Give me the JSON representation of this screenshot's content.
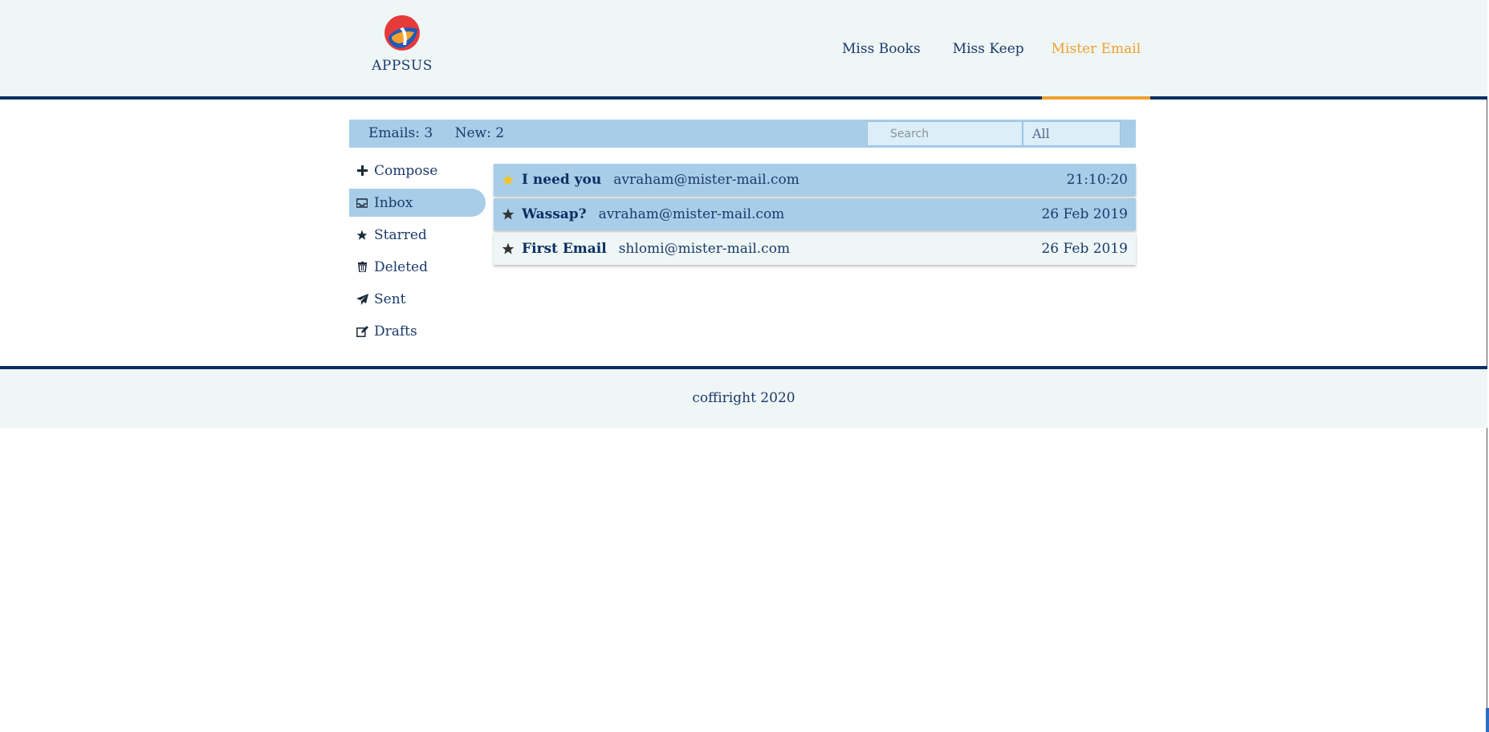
{
  "app": {
    "logo_text": "APPSUS"
  },
  "nav": {
    "items": [
      {
        "label": "Miss Books"
      },
      {
        "label": "Miss Keep"
      },
      {
        "label": "Mister Email"
      }
    ],
    "active": "Mister Email",
    "active_color": "#f0a030"
  },
  "status": {
    "emails_label": "Emails: 3",
    "new_label": "New: 2"
  },
  "search": {
    "placeholder": "Search",
    "value": ""
  },
  "filter": {
    "selected": "All"
  },
  "sidebar": {
    "items": [
      {
        "label": "Compose",
        "icon": "plus-icon"
      },
      {
        "label": "Inbox",
        "icon": "inbox-icon"
      },
      {
        "label": "Starred",
        "icon": "star-icon"
      },
      {
        "label": "Deleted",
        "icon": "trash-icon"
      },
      {
        "label": "Sent",
        "icon": "paper-plane-icon"
      },
      {
        "label": "Drafts",
        "icon": "edit-icon"
      }
    ],
    "active": "Inbox"
  },
  "emails": [
    {
      "subject": "I need you",
      "from": "avraham@mister-mail.com",
      "date": "21:10:20",
      "starred": true,
      "read": false
    },
    {
      "subject": "Wassap?",
      "from": "avraham@mister-mail.com",
      "date": "26 Feb 2019",
      "starred": false,
      "read": false
    },
    {
      "subject": "First Email",
      "from": "shlomi@mister-mail.com",
      "date": "26 Feb 2019",
      "starred": false,
      "read": true
    }
  ],
  "footer": {
    "text": "coffiright 2020"
  },
  "colors": {
    "primary": "#0b2f63",
    "header_bg": "#eff6f6",
    "unread_bg": "#a8cde8",
    "star_active": "#f5c518",
    "star_inactive": "#333333"
  }
}
